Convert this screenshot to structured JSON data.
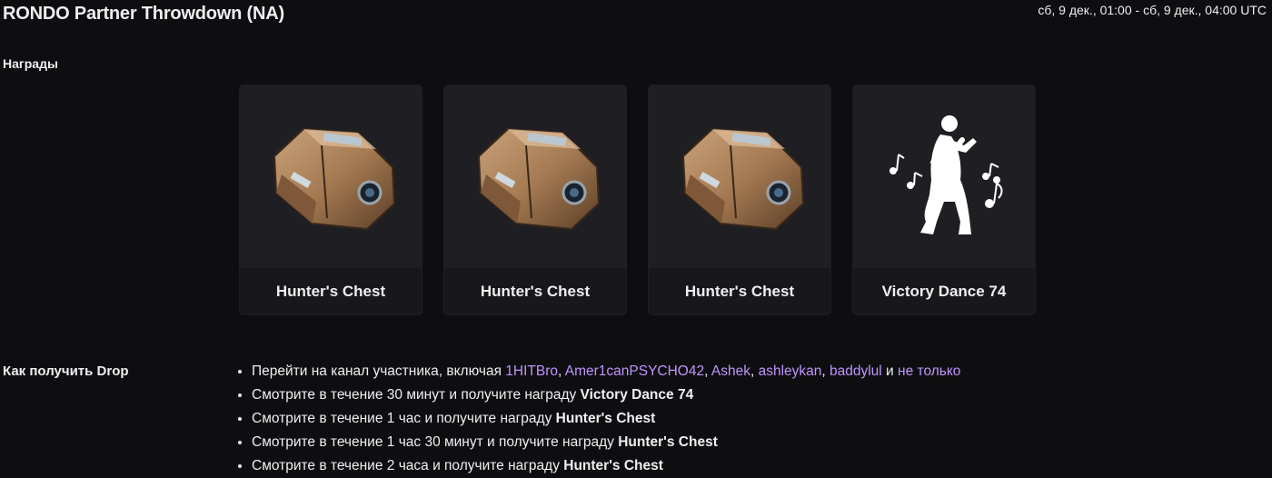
{
  "header": {
    "title": "RONDO Partner Throwdown (NA)",
    "date_range": "сб, 9 дек., 01:00 - сб, 9 дек., 04:00 UTC"
  },
  "rewards": {
    "label": "Награды",
    "items": [
      {
        "name": "Hunter's Chest",
        "icon": "hunters-chest-icon"
      },
      {
        "name": "Hunter's Chest",
        "icon": "hunters-chest-icon"
      },
      {
        "name": "Hunter's Chest",
        "icon": "hunters-chest-icon"
      },
      {
        "name": "Victory Dance 74",
        "icon": "victory-dance-icon"
      }
    ]
  },
  "how_to": {
    "label": "Как получить Drop",
    "step1_prefix": "Перейти на канал участника, включая ",
    "channels": [
      "1HITBro",
      "Amer1canPSYCHO42",
      "Ashek",
      "ashleykan",
      "baddylul"
    ],
    "sep": ", ",
    "and": " и ",
    "more_link": "не только",
    "steps": [
      {
        "text": "Смотрите в течение 30 минут и получите награду ",
        "reward": "Victory Dance 74"
      },
      {
        "text": "Смотрите в течение 1 час и получите награду ",
        "reward": "Hunter's Chest"
      },
      {
        "text": "Смотрите в течение 1 час 30 минут и получите награду ",
        "reward": "Hunter's Chest"
      },
      {
        "text": "Смотрите в течение 2 часа и получите награду ",
        "reward": "Hunter's Chest"
      }
    ]
  },
  "colors": {
    "background": "#0e0e10",
    "card": "#18181b",
    "link": "#bf94ff",
    "text": "#efeff1"
  }
}
